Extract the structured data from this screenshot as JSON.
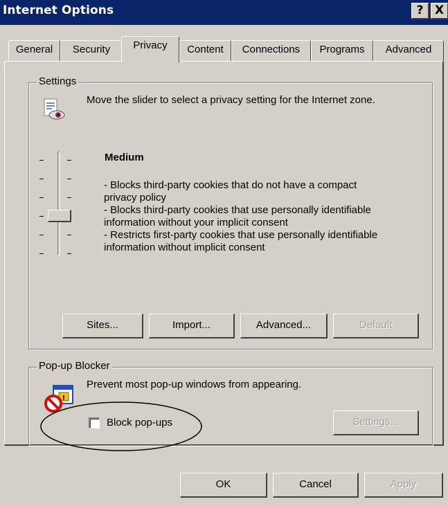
{
  "window": {
    "title": "Internet Options",
    "help_btn": "?",
    "close_btn": "X"
  },
  "tabs": [
    {
      "label": "General"
    },
    {
      "label": "Security"
    },
    {
      "label": "Privacy",
      "active": true
    },
    {
      "label": "Content"
    },
    {
      "label": "Connections"
    },
    {
      "label": "Programs"
    },
    {
      "label": "Advanced"
    }
  ],
  "settings": {
    "group_label": "Settings",
    "icon": "privacy-eye-icon",
    "description": "Move the slider to select a privacy setting for the Internet zone.",
    "level_title": "Medium",
    "level_lines": [
      "- Blocks third-party cookies that do not have a compact",
      "privacy policy",
      "- Blocks third-party cookies that use personally identifiable",
      "information without your implicit consent",
      "- Restricts first-party cookies that use personally identifiable",
      "information without implicit consent"
    ],
    "slider_positions": 6,
    "slider_selected_index_from_top": 3,
    "buttons": {
      "sites": "Sites...",
      "import": "Import...",
      "advanced": "Advanced...",
      "default": "Default"
    }
  },
  "popup": {
    "group_label": "Pop-up Blocker",
    "icon": "popup-blocked-icon",
    "description": "Prevent most pop-up windows from appearing.",
    "checkbox_label": "Block pop-ups",
    "checkbox_checked": false,
    "settings_button": "Settings..."
  },
  "footer": {
    "ok": "OK",
    "cancel": "Cancel",
    "apply": "Apply"
  },
  "colors": {
    "titlebar": "#0a246a",
    "face": "#d4d0c8",
    "annotation_ellipse": "#000000"
  }
}
